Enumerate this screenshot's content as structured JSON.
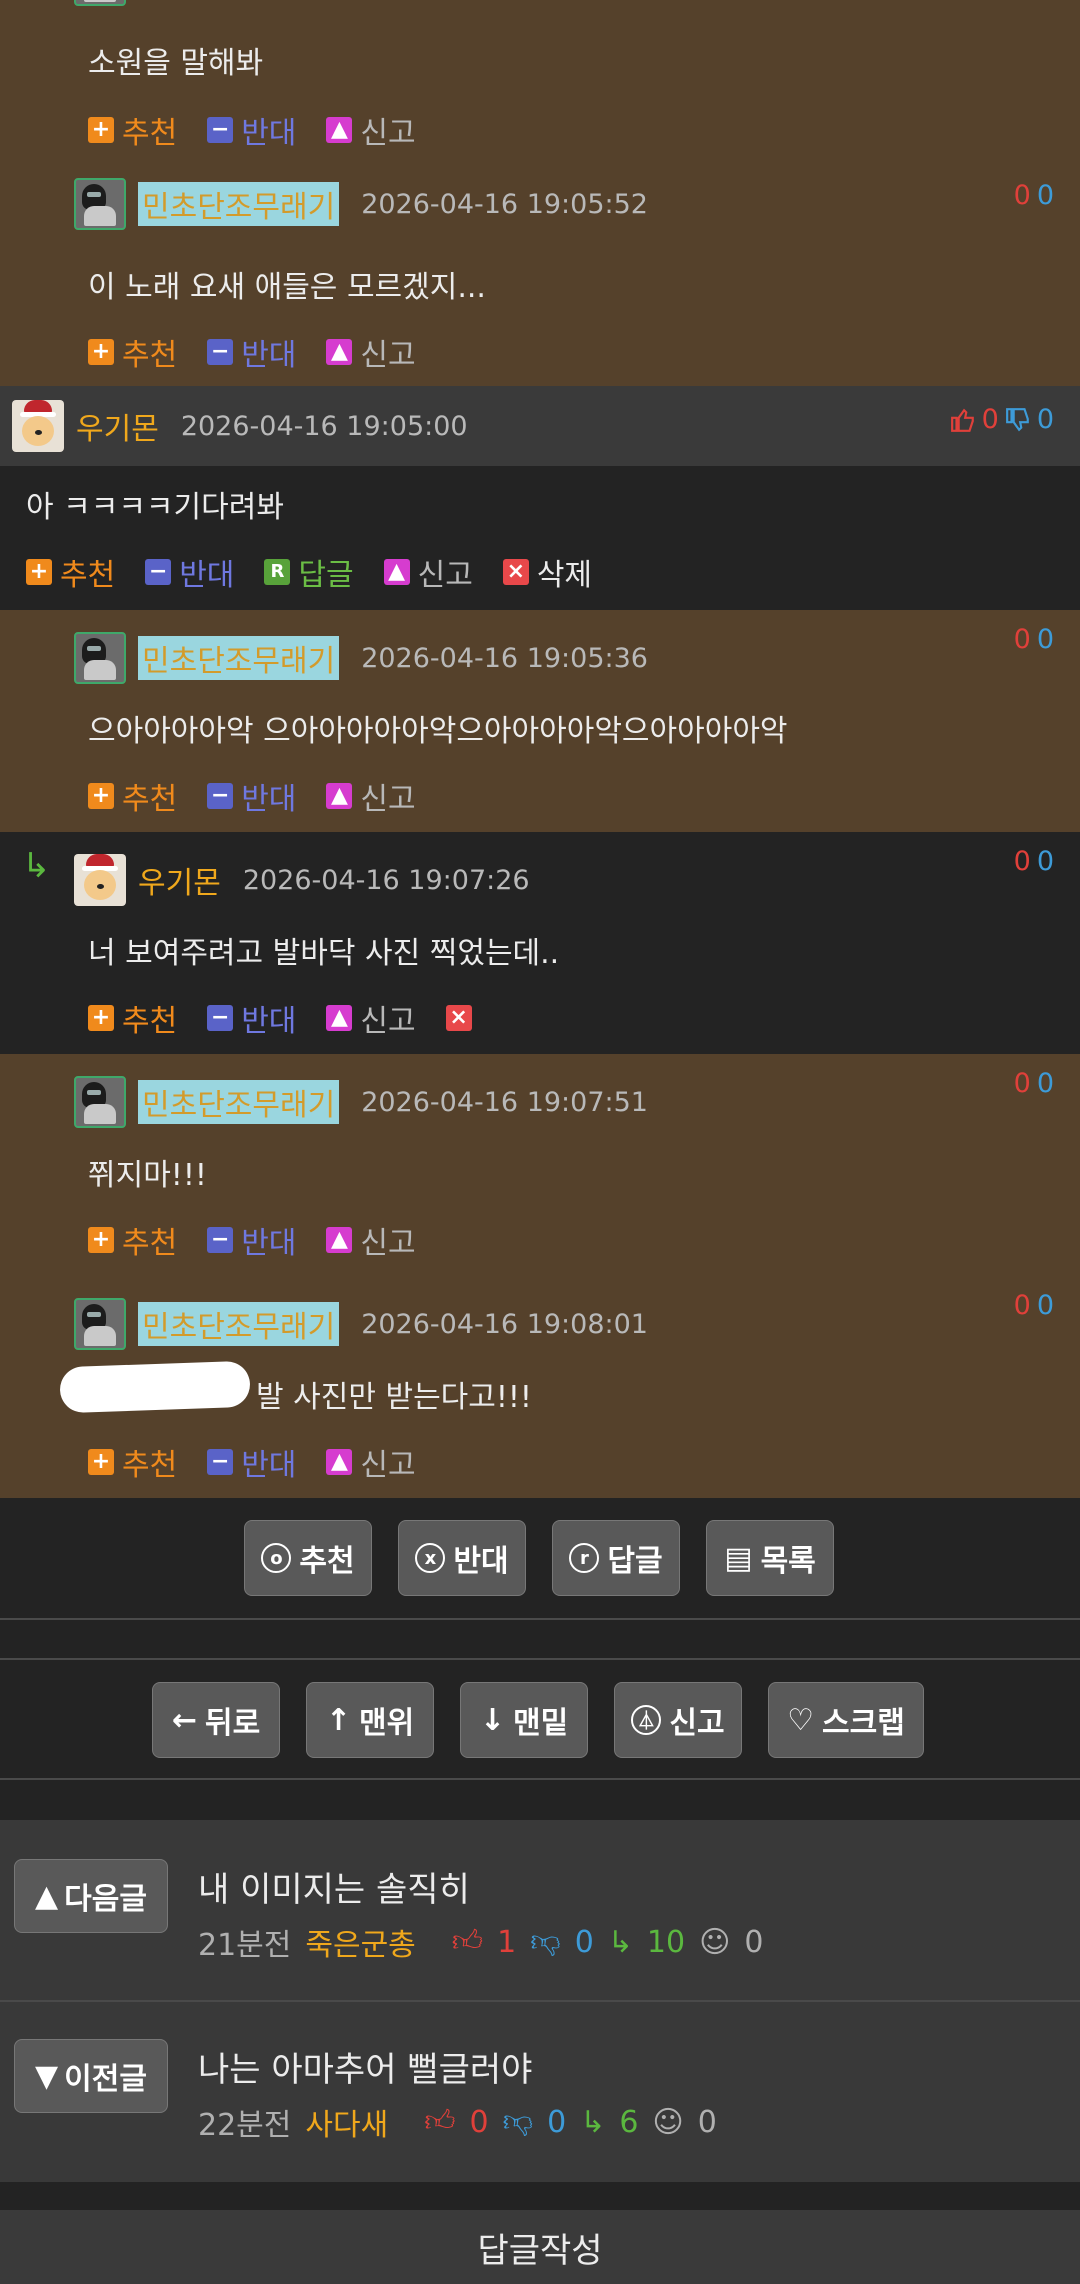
{
  "comments": [
    {
      "id": "c0",
      "nick": "",
      "time": "",
      "text": "소원을 말해봐",
      "up": "",
      "down": ""
    },
    {
      "id": "c1",
      "nick": "민초단조무래기",
      "time": "2026-04-16 19:05:52",
      "text": "이 노래 요새 애들은 모르겠지...",
      "up": "0",
      "down": "0"
    },
    {
      "id": "c2",
      "nick": "우기몬",
      "time": "2026-04-16 19:05:00",
      "text": "아 ㅋㅋㅋㅋ기다려봐",
      "up": "0",
      "down": "0"
    },
    {
      "id": "c3",
      "nick": "민초단조무래기",
      "time": "2026-04-16 19:05:36",
      "text": "으아아아아악 으아아아아아악으아아아아악으아아아아악",
      "up": "0",
      "down": "0"
    },
    {
      "id": "c4",
      "nick": "우기몬",
      "time": "2026-04-16 19:07:26",
      "text": "너 보여주려고 발바닥 사진 찍었는데..",
      "up": "0",
      "down": "0"
    },
    {
      "id": "c5",
      "nick": "민초단조무래기",
      "time": "2026-04-16 19:07:51",
      "text": "쮜지마!!!",
      "up": "0",
      "down": "0"
    },
    {
      "id": "c6",
      "nick": "민초단조무래기",
      "time": "2026-04-16 19:08:01",
      "text": "발 사진만 받는다고!!!",
      "up": "0",
      "down": "0"
    }
  ],
  "actions": {
    "recommend": "추천",
    "oppose": "반대",
    "reply": "답글",
    "report": "신고",
    "delete": "삭제",
    "reply_icon": "R"
  },
  "post_buttons": {
    "recommend": "추천",
    "oppose": "반대",
    "reply": "답글",
    "list": "목록"
  },
  "nav_buttons": {
    "back": "뒤로",
    "top": "맨위",
    "bottom": "맨밑",
    "report": "신고",
    "scrap": "스크랩"
  },
  "next_post": {
    "label": "다음글",
    "title": "내 이미지는 솔직히",
    "ago": "21분전",
    "author": "죽은군총",
    "up": "1",
    "down": "0",
    "replies": "10",
    "views": "0"
  },
  "prev_post": {
    "label": "이전글",
    "title": "나는 아마추어 뻘글러야",
    "ago": "22분전",
    "author": "사다새",
    "up": "0",
    "down": "0",
    "replies": "6",
    "views": "0"
  },
  "compose": "답글작성",
  "colors": {
    "brown": "#55412b",
    "accent_orange": "#f08a1c",
    "accent_blue": "#5a63c8"
  }
}
